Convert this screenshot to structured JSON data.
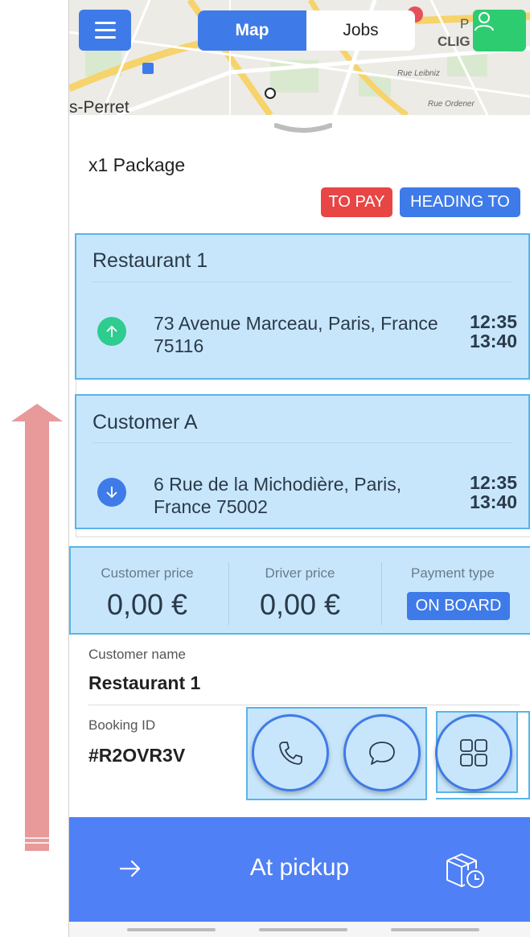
{
  "header": {
    "tabs": [
      {
        "label": "Map",
        "active": true
      },
      {
        "label": "Jobs",
        "active": false
      }
    ]
  },
  "map": {
    "place_label": "s-Perret",
    "street_1": "Rue Leibniz",
    "street_2": "Rue Ordener",
    "area_label": "CLIG",
    "area_label_2": "P"
  },
  "job": {
    "title": "x1 Package",
    "badges": [
      {
        "label": "TO PAY",
        "color": "#e84545"
      },
      {
        "label": "HEADING TO",
        "color": "#3f7be8"
      }
    ]
  },
  "stops": [
    {
      "name": "Restaurant 1",
      "address": "73 Avenue Marceau, Paris, France 75116",
      "time_start": "12:35",
      "time_end": "13:40",
      "direction": "pickup",
      "icon": "arrow-up-icon",
      "color": "#2ecc8f"
    },
    {
      "name": "Customer A",
      "address": "6 Rue de la Michodière, Paris, France 75002",
      "time_start": "12:35",
      "time_end": "13:40",
      "direction": "dropoff",
      "icon": "arrow-down-icon",
      "color": "#3f7be8"
    }
  ],
  "prices": {
    "customer_label": "Customer price",
    "customer_value": "0,00 €",
    "driver_label": "Driver price",
    "driver_value": "0,00 €",
    "payment_label": "Payment type",
    "payment_value": "ON BOARD"
  },
  "details": {
    "customer_name_label": "Customer name",
    "customer_name": "Restaurant 1",
    "booking_label": "Booking ID",
    "booking_id": "#R2OVR3V"
  },
  "actions": {
    "icons": [
      "phone-icon",
      "chat-icon",
      "grid-icon"
    ]
  },
  "bottom_bar": {
    "label": "At pickup",
    "left_icon": "arrow-right-icon",
    "right_icon": "package-clock-icon"
  },
  "colors": {
    "primary": "#3f7be8",
    "success": "#2ecc71",
    "danger": "#e84545",
    "highlight": "#c8e6fb",
    "highlight_border": "#5ab4e8",
    "bottom_bar": "#5080f5"
  }
}
